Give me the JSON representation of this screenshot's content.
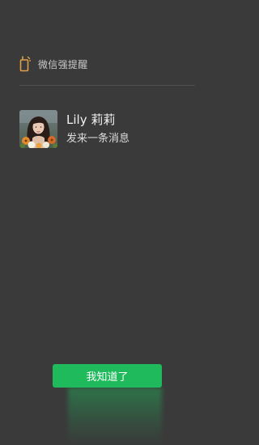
{
  "header": {
    "icon": "phone-alert-icon",
    "title": "微信强提醒",
    "accent": "#e0a04a"
  },
  "message": {
    "avatar": "contact-photo",
    "sender": "Lily 莉莉",
    "preview": "发来一条消息"
  },
  "actions": {
    "confirm_label": "我知道了",
    "confirm_color": "#1fba5c"
  }
}
